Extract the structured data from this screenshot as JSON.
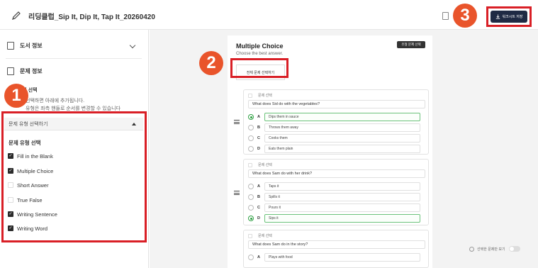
{
  "header": {
    "title": "리딩클럽_Sip It, Dip It, Tap It_20260420",
    "save_label": "워크시트 저장"
  },
  "sidebar": {
    "book_info": "도서 정보",
    "question_info": "문제 정보",
    "guide_head": "문제 유형 선택",
    "guide_line1": "선택하면 아래에 추가됩니다.",
    "guide_line2": "유형은 좌측 핸들로 순서를 변경할 수 있습니다",
    "dropdown_label": "문제 유형 선택하기",
    "list_head": "문제 유형 선택",
    "options": [
      {
        "label": "Fill in the Blank",
        "checked": true
      },
      {
        "label": "Multiple Choice",
        "checked": true
      },
      {
        "label": "Short Answer",
        "checked": false
      },
      {
        "label": "True False",
        "checked": false
      },
      {
        "label": "Writing Sentence",
        "checked": true
      },
      {
        "label": "Writing Word",
        "checked": true
      }
    ]
  },
  "panel": {
    "title": "Multiple Choice",
    "subtitle": "Choose the best answer.",
    "type_button": "유형 문제 선택",
    "select_all": "전체 문제 선택하기",
    "question_label": "문제 선택"
  },
  "questions": [
    {
      "q": "What does Sid do with the vegetables?",
      "answers": [
        {
          "letter": "A",
          "text": "Dips them in sauce",
          "correct": true
        },
        {
          "letter": "B",
          "text": "Throws them away",
          "correct": false
        },
        {
          "letter": "C",
          "text": "Cooks them",
          "correct": false
        },
        {
          "letter": "D",
          "text": "Eats them plain",
          "correct": false
        }
      ]
    },
    {
      "q": "What does Sam do with her drink?",
      "answers": [
        {
          "letter": "A",
          "text": "Taps it",
          "correct": false
        },
        {
          "letter": "B",
          "text": "Spills it",
          "correct": false
        },
        {
          "letter": "C",
          "text": "Pours it",
          "correct": false
        },
        {
          "letter": "D",
          "text": "Sips it",
          "correct": true
        }
      ]
    },
    {
      "q": "What does Sam do in the story?",
      "answers": [
        {
          "letter": "A",
          "text": "Plays with food",
          "correct": false
        }
      ]
    }
  ],
  "footer": {
    "toggle_label": "선택한 문제만 보기"
  },
  "annotations": [
    "1",
    "2",
    "3"
  ],
  "colors": {
    "annotation_red": "#d91f26",
    "badge_orange": "#e9542b",
    "save_button": "#1f2a44",
    "correct_green": "#2ea043"
  }
}
